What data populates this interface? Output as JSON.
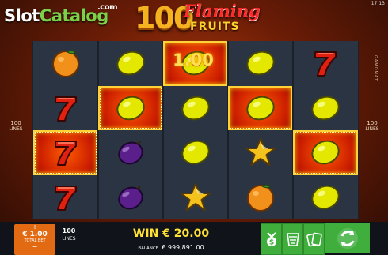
{
  "header": {
    "brand_slot": "Slot",
    "brand_catalog": "Catalog",
    "brand_domain": ".com",
    "logo_number": "100",
    "logo_flaming": "Flaming",
    "logo_fruits": "FRUITS",
    "clock": "17:13"
  },
  "lines_left": {
    "value": "100",
    "label": "LINES"
  },
  "lines_right": {
    "value": "100",
    "label": "LINES"
  },
  "provider": "GAMOMAT",
  "win_overlay": "1.00",
  "reels": {
    "columns": [
      [
        {
          "symbol": "orange",
          "win": false
        },
        {
          "symbol": "seven",
          "win": false
        },
        {
          "symbol": "seven",
          "win": true
        },
        {
          "symbol": "seven",
          "win": false
        }
      ],
      [
        {
          "symbol": "lemon",
          "win": false
        },
        {
          "symbol": "lemon",
          "win": true
        },
        {
          "symbol": "plum",
          "win": false
        },
        {
          "symbol": "plum",
          "win": false
        }
      ],
      [
        {
          "symbol": "lemon",
          "win": true
        },
        {
          "symbol": "lemon",
          "win": false
        },
        {
          "symbol": "lemon",
          "win": false
        },
        {
          "symbol": "star",
          "win": false
        }
      ],
      [
        {
          "symbol": "lemon",
          "win": false
        },
        {
          "symbol": "lemon",
          "win": true
        },
        {
          "symbol": "star",
          "win": false
        },
        {
          "symbol": "orange",
          "win": false
        }
      ],
      [
        {
          "symbol": "seven",
          "win": false
        },
        {
          "symbol": "lemon",
          "win": false
        },
        {
          "symbol": "lemon",
          "win": true
        },
        {
          "symbol": "lemon",
          "win": false
        }
      ]
    ]
  },
  "bottom": {
    "bet_plus": "+",
    "bet_minus": "−",
    "total_bet_value": "€ 1.00",
    "total_bet_label": "TOTAL BET",
    "lines_value": "100",
    "lines_label": "LINES",
    "win_text": "WIN € 20.00",
    "balance_label": "BALANCE",
    "balance_value": "€ 999,891.00",
    "buttons": [
      "gamble-icon",
      "paytable-icon",
      "cards-icon",
      "autospin-icon"
    ]
  },
  "colors": {
    "accent_orange": "#e26a12",
    "button_green": "#3fae3c",
    "win_yellow": "#ffe033"
  }
}
